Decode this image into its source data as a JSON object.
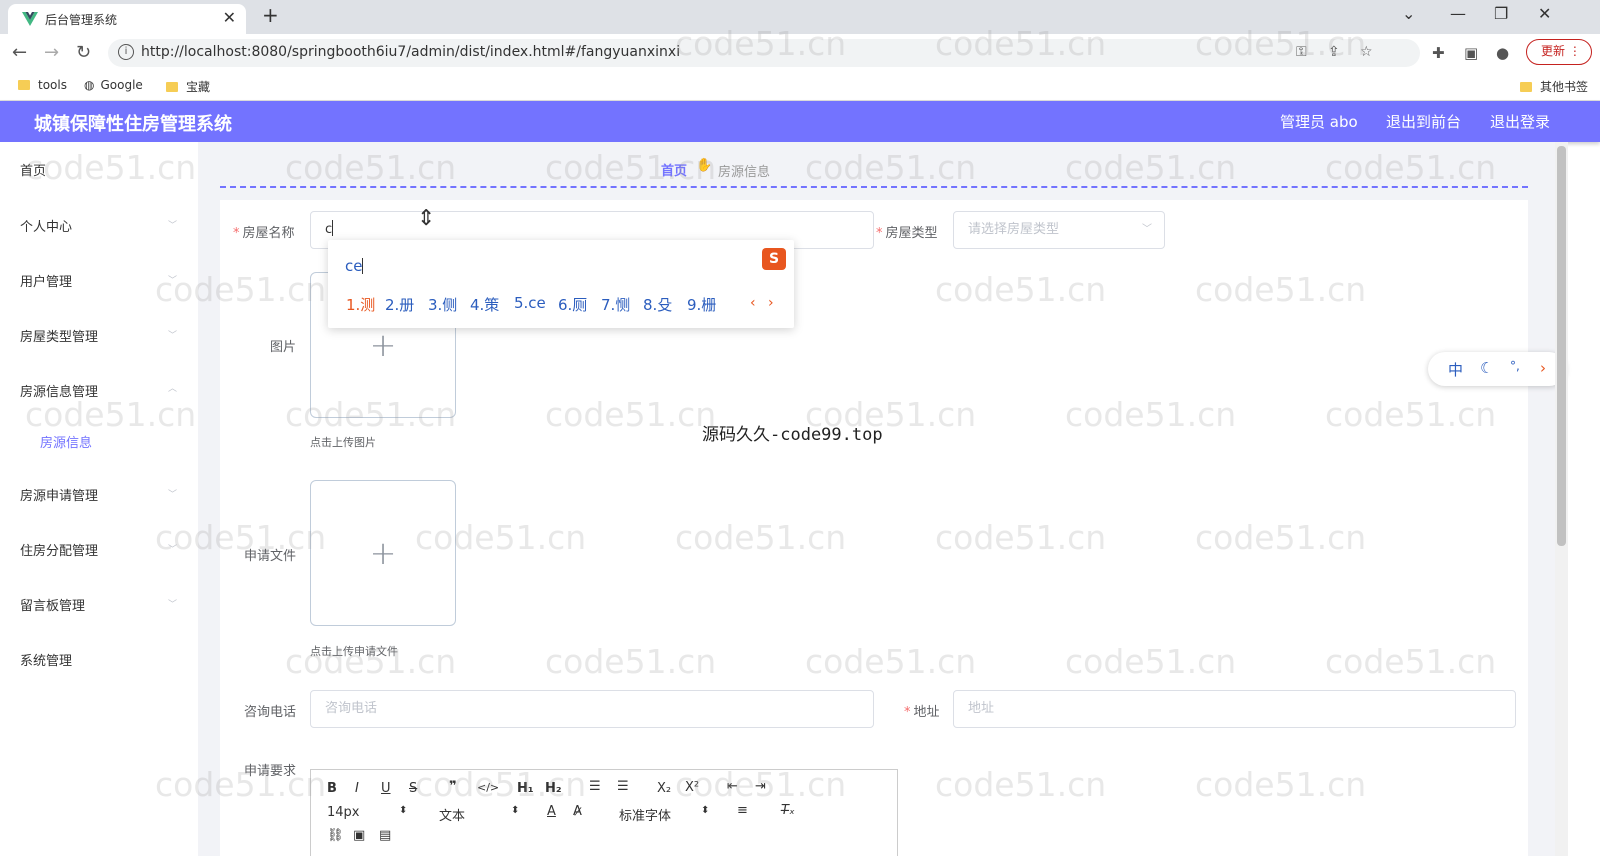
{
  "browser": {
    "tab_title": "后台管理系统",
    "url": "http://localhost:8080/springbooth6iu7/admin/dist/index.html#/fangyuanxinxi",
    "update_label": "更新",
    "bookmarks": [
      "tools",
      "Google",
      "宝藏"
    ],
    "other_bookmarks": "其他书签"
  },
  "header": {
    "title": "城镇保障性住房管理系统",
    "user": "管理员 abo",
    "to_front": "退出到前台",
    "logout": "退出登录"
  },
  "sidebar": {
    "items": [
      "首页",
      "个人中心",
      "用户管理",
      "房屋类型管理",
      "房源信息管理",
      "房源申请管理",
      "住房分配管理",
      "留言板管理",
      "系统管理"
    ],
    "sub_item": "房源信息"
  },
  "breadcrumb": {
    "home": "首页",
    "current": "房源信息"
  },
  "form": {
    "house_name_label": "房屋名称",
    "house_name_value": "c",
    "house_type_label": "房屋类型",
    "house_type_placeholder": "请选择房屋类型",
    "image_label": "图片",
    "image_tip": "点击上传图片",
    "file_label": "申请文件",
    "file_tip": "点击上传申请文件",
    "phone_label": "咨询电话",
    "phone_placeholder": "咨询电话",
    "address_label": "地址",
    "address_placeholder": "地址",
    "requirement_label": "申请要求"
  },
  "editor": {
    "font_size": "14px",
    "paragraph": "文本",
    "font_family": "标准字体"
  },
  "ime": {
    "input": "ce",
    "candidates": [
      "1.测",
      "2.册",
      "3.侧",
      "4.策",
      "5.ce",
      "6.厕",
      "7.恻",
      "8.殳",
      "9.栅"
    ],
    "status": [
      "中",
      "°,"
    ]
  },
  "watermark": {
    "text": "code51.cn",
    "center": "源码久久-code99.top"
  }
}
